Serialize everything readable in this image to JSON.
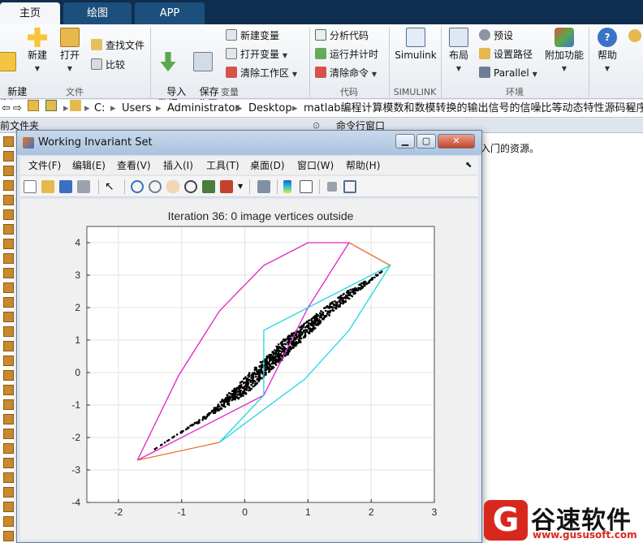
{
  "tabs": [
    {
      "label": "主页",
      "active": true
    },
    {
      "label": "绘图",
      "active": false
    },
    {
      "label": "APP",
      "active": false
    }
  ],
  "ribbon": {
    "new_script": "新建\n脚本",
    "new": "新建",
    "open": "打开",
    "find_files": "查找文件",
    "compare": "比较",
    "import_data": "导入\n数据",
    "save_workspace": "保存\n工作区",
    "new_variable": "新建变量",
    "open_variable": "打开变量",
    "clear_workspace": "清除工作区",
    "analyze_code": "分析代码",
    "run_and_time": "运行并计时",
    "clear_commands": "清除命令",
    "simulink": "Simulink",
    "layout": "布局",
    "preferences": "预设",
    "set_path": "设置路径",
    "parallel": "Parallel",
    "addons": "附加功能",
    "help": "帮助",
    "sections": {
      "file": "文件",
      "variable": "变量",
      "code": "代码",
      "simulink": "SIMULINK",
      "environment": "环境"
    }
  },
  "address": {
    "segments": [
      "C:",
      "Users",
      "Administrator",
      "Desktop",
      "matlab编程计算模数和数模转换的输出信号的信噪比等动态特性源码程序"
    ]
  },
  "panels": {
    "current_folder": "前文件夹",
    "command_window": "命令行窗口",
    "cmd_text": "入门的资源。"
  },
  "figure": {
    "title": "Working Invariant Set",
    "menu": [
      "文件(F)",
      "编辑(E)",
      "查看(V)",
      "插入(I)",
      "工具(T)",
      "桌面(D)",
      "窗口(W)",
      "帮助(H)"
    ]
  },
  "watermark": {
    "logo": "G",
    "name": "谷速软件",
    "url": "www.gususoft.com"
  },
  "colors": {
    "magenta": "#e020c8",
    "cyan": "#1ed6e0",
    "orange": "#e8722a",
    "points": "#000000"
  },
  "chart_data": {
    "type": "line",
    "title": "Iteration 36: 0 image vertices outside",
    "xlim": [
      -2.5,
      3.0
    ],
    "ylim": [
      -4,
      4.5
    ],
    "xticks": [
      -2,
      -1,
      0,
      1,
      2,
      3
    ],
    "yticks": [
      -4,
      -3,
      -2,
      -1,
      0,
      1,
      2,
      3,
      4
    ],
    "grid": true,
    "series": [
      {
        "color": "#e020c8",
        "points": [
          [
            -1.7,
            -2.7
          ],
          [
            -1.05,
            -0.1
          ],
          [
            -0.4,
            1.9
          ],
          [
            0.3,
            3.3
          ],
          [
            1.0,
            4.0
          ],
          [
            1.65,
            4.0
          ],
          [
            1.0,
            2.0
          ],
          [
            0.3,
            -0.7
          ],
          [
            -1.7,
            -2.7
          ]
        ]
      },
      {
        "color": "#1ed6e0",
        "points": [
          [
            -0.4,
            -2.15
          ],
          [
            0.3,
            -0.7
          ],
          [
            0.3,
            1.3
          ],
          [
            1.0,
            2.0
          ],
          [
            2.3,
            3.3
          ],
          [
            1.65,
            1.3
          ],
          [
            0.95,
            -0.2
          ],
          [
            -0.4,
            -2.15
          ]
        ]
      },
      {
        "color": "#e8722a",
        "points": [
          [
            -1.7,
            -2.7
          ],
          [
            -0.4,
            -2.15
          ]
        ]
      },
      {
        "color": "#e8722a",
        "points": [
          [
            1.65,
            4.0
          ],
          [
            2.3,
            3.3
          ]
        ]
      }
    ],
    "scatter_region": [
      [
        -1.5,
        -2.45
      ],
      [
        -0.6,
        -1.3
      ],
      [
        0.6,
        1.0
      ],
      [
        1.6,
        2.5
      ],
      [
        2.2,
        3.15
      ],
      [
        1.3,
        1.7
      ],
      [
        0.0,
        -0.7
      ],
      [
        -1.2,
        -2.1
      ]
    ]
  }
}
